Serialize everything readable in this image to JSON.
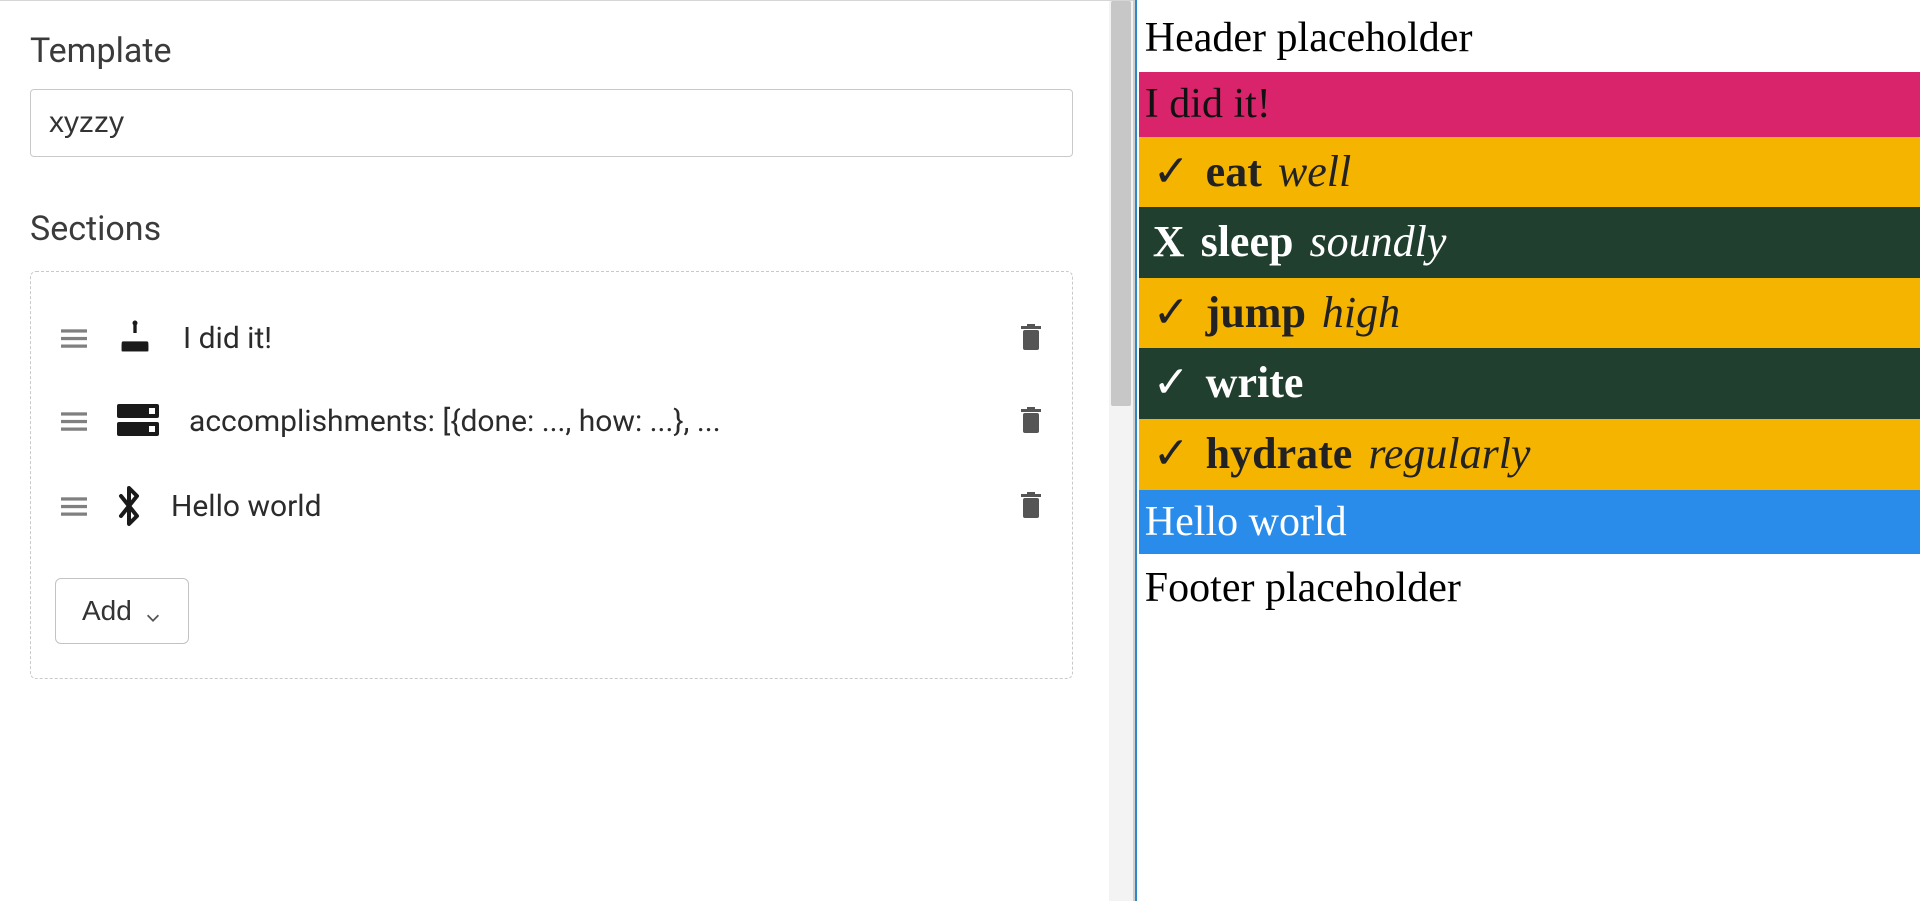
{
  "editor": {
    "templateLabel": "Template",
    "templateValue": "xyzzy",
    "sectionsLabel": "Sections",
    "addLabel": "Add",
    "sections": [
      {
        "icon": "cake-icon",
        "label": "I did it!"
      },
      {
        "icon": "datagroup-icon",
        "label": "accomplishments: [{done: ..., how: ...}, ..."
      },
      {
        "icon": "bluetooth-icon",
        "label": "Hello world"
      }
    ]
  },
  "preview": {
    "header": "Header placeholder",
    "footer": "Footer placeholder",
    "pinkLine": "I did it!",
    "blueLine": "Hello world",
    "accomplishments": [
      {
        "mark": "check",
        "title": "eat",
        "how": "well",
        "tone": "gold"
      },
      {
        "mark": "x",
        "title": "sleep",
        "how": "soundly",
        "tone": "green"
      },
      {
        "mark": "check",
        "title": "jump",
        "how": "high",
        "tone": "gold"
      },
      {
        "mark": "check",
        "title": "write",
        "how": "",
        "tone": "green"
      },
      {
        "mark": "check",
        "title": "hydrate",
        "how": "regularly",
        "tone": "gold"
      }
    ]
  },
  "colors": {
    "magenta": "#d9246b",
    "gold": "#f5b400",
    "green": "#203f2e",
    "blue": "#2a8cea"
  }
}
